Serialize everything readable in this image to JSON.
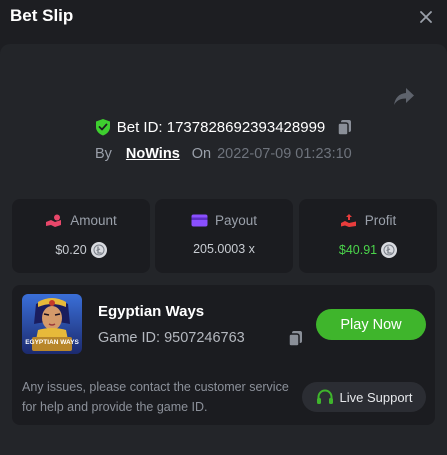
{
  "header": {
    "title": "Bet Slip",
    "close_icon": "close-icon"
  },
  "bet": {
    "id_text": "Bet ID: 1737828692393428999",
    "by_label": "By",
    "user": "NoWins",
    "on_label": "On",
    "date": "2022-07-09 01:23:10"
  },
  "stats": [
    {
      "label": "Amount",
      "value": "$0.20",
      "icon": "amount-icon",
      "color": "#e8476a"
    },
    {
      "label": "Payout",
      "value": "205.0003 x",
      "icon": "payout-icon",
      "color": "#8a4fff"
    },
    {
      "label": "Profit",
      "value": "$40.91",
      "icon": "profit-icon",
      "color": "#e83c3c"
    }
  ],
  "game": {
    "name": "Egyptian Ways",
    "thumb_text": "EGYPTIAN WAYS",
    "id_text": "Game ID: 9507246763",
    "play_label": "Play Now"
  },
  "support": {
    "message": "Any issues, please contact the customer service for help and provide the game ID.",
    "button_label": "Live Support"
  },
  "colors": {
    "accent_green": "#3fb52c",
    "profit_green": "#4bd44b",
    "shield_green": "#3ecf2f",
    "background": "#1d1e22",
    "panel": "#232529",
    "card": "#1b1c20"
  }
}
